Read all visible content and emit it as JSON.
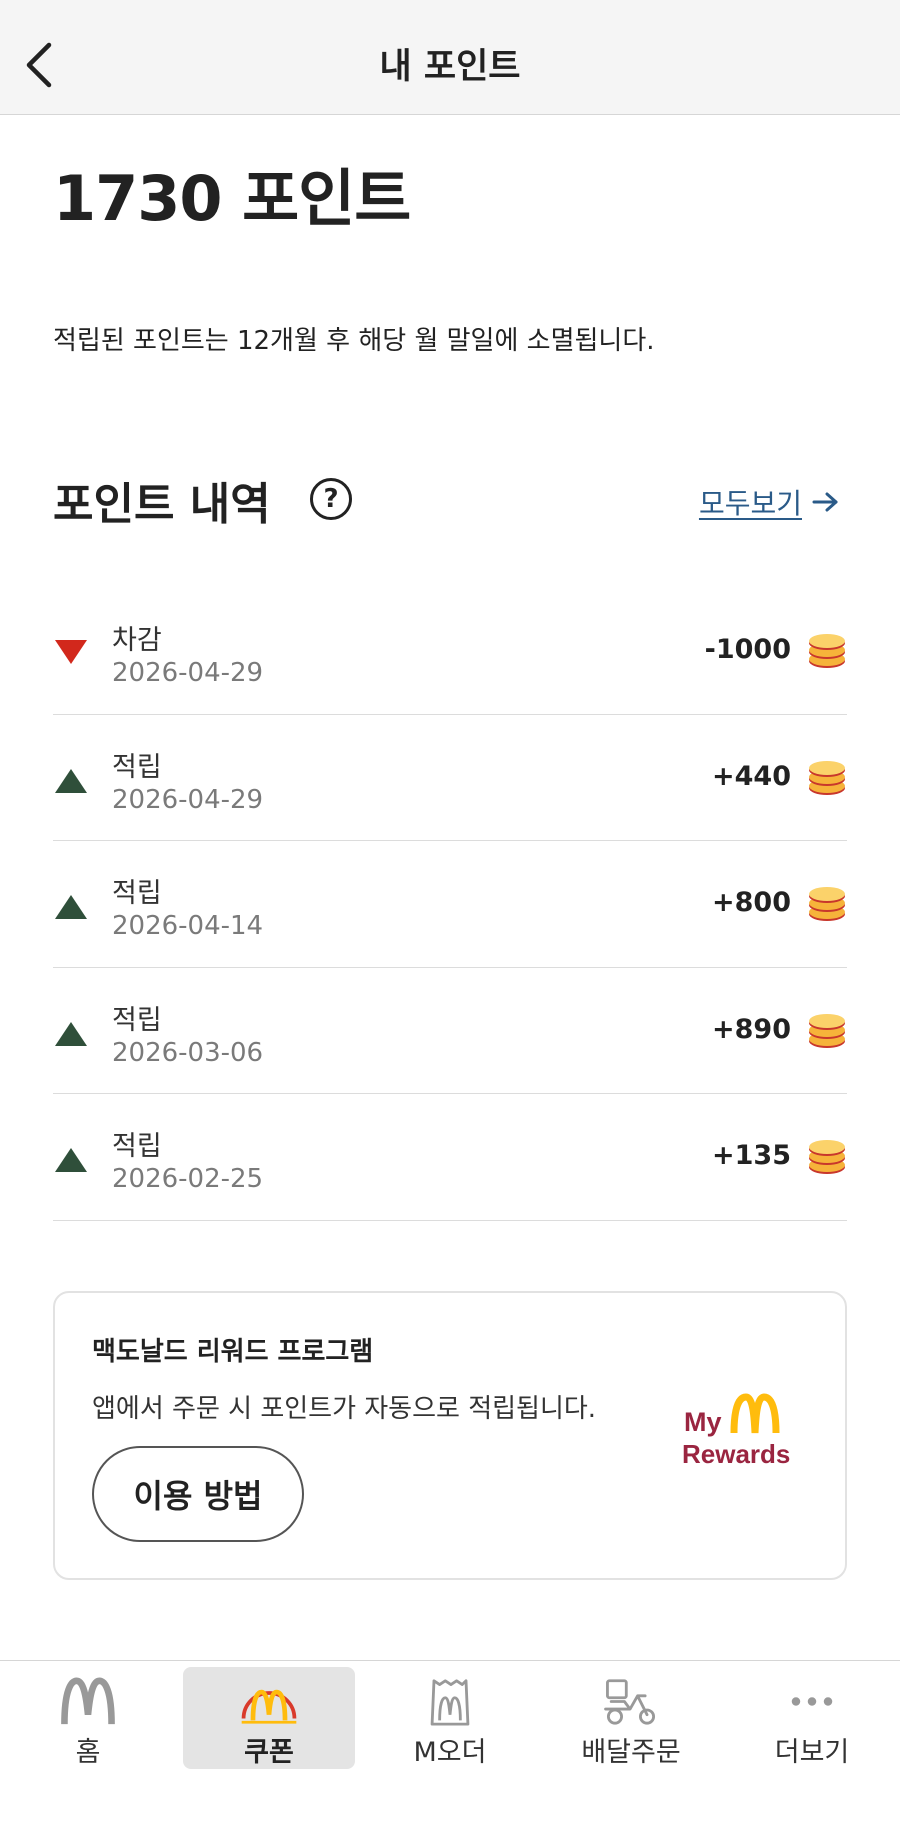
{
  "header": {
    "title": "내 포인트",
    "back_icon": "chevron-left-icon"
  },
  "summary": {
    "points_total": "1730 포인트",
    "expiry_note": "적립된 포인트는 12개월 후 해당 월 말일에 소멸됩니다."
  },
  "history": {
    "title": "포인트 내역",
    "help_label": "?",
    "view_all_label": "모두보기",
    "rows": [
      {
        "type": "차감",
        "date": "2026-04-29",
        "amount": "-1000",
        "direction": "down"
      },
      {
        "type": "적립",
        "date": "2026-04-29",
        "amount": "+440",
        "direction": "up"
      },
      {
        "type": "적립",
        "date": "2026-04-14",
        "amount": "+800",
        "direction": "up"
      },
      {
        "type": "적립",
        "date": "2026-03-06",
        "amount": "+890",
        "direction": "up"
      },
      {
        "type": "적립",
        "date": "2026-02-25",
        "amount": "+135",
        "direction": "up"
      }
    ]
  },
  "rewards_card": {
    "title": "맥도날드 리워드 프로그램",
    "description": "앱에서 주문 시 포인트가 자동으로 적립됩니다.",
    "button_label": "이용 방법",
    "logo_my": "My",
    "logo_rewards": "Rewards"
  },
  "tabbar": {
    "tabs": [
      {
        "label": "홈",
        "icon": "golden-arches-icon"
      },
      {
        "label": "쿠폰",
        "icon": "coupon-arches-icon",
        "active": true
      },
      {
        "label": "M오더",
        "icon": "m-order-bag-icon"
      },
      {
        "label": "배달주문",
        "icon": "delivery-scooter-icon"
      },
      {
        "label": "더보기",
        "icon": "more-dots-icon"
      }
    ]
  },
  "colors": {
    "up": "#2f4f3a",
    "down": "#d2281c",
    "link": "#2a5a88",
    "arches_gold": "#ffbc0d",
    "rewards_red": "#9a2540"
  }
}
